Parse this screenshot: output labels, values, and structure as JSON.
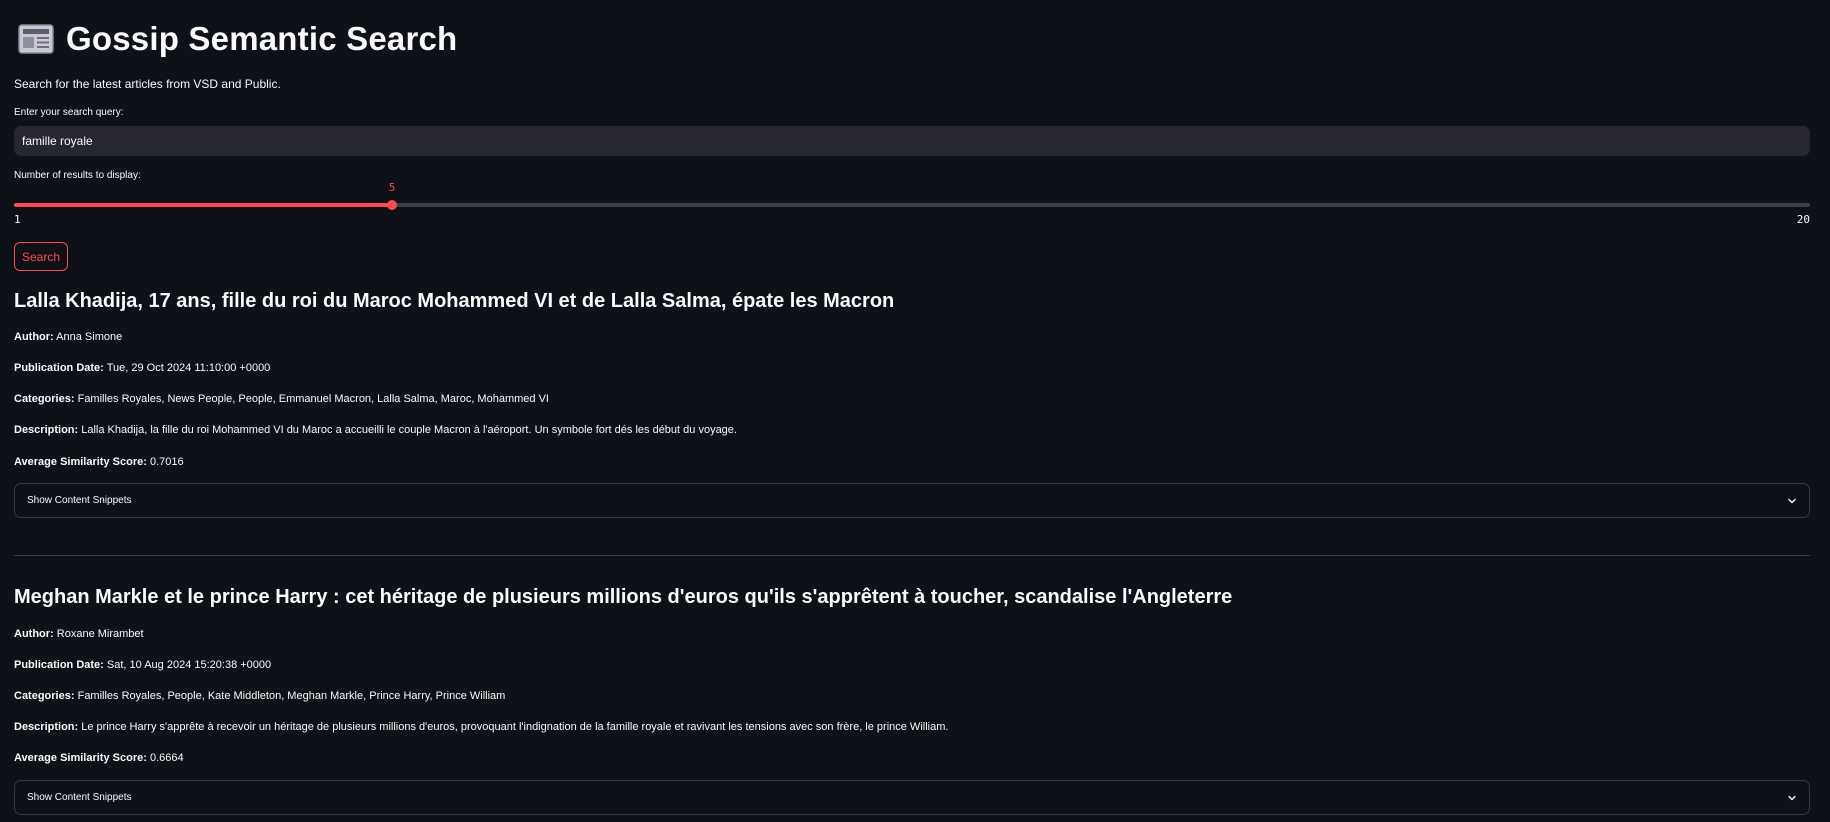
{
  "header": {
    "icon": "newspaper-icon",
    "title": "Gossip Semantic Search",
    "subtitle": "Search for the latest articles from VSD and Public."
  },
  "search": {
    "label": "Enter your search query:",
    "value": "famille royale"
  },
  "results_slider": {
    "label": "Number of results to display:",
    "value": 5,
    "value_text": "5",
    "min": 1,
    "max": 20,
    "min_text": "1",
    "max_text": "20",
    "accent_color": "#ff4b4b"
  },
  "search_button": {
    "label": "Search"
  },
  "labels": {
    "author": "Author:",
    "publication_date": "Publication Date:",
    "categories": "Categories:",
    "description": "Description:",
    "score": "Average Similarity Score:"
  },
  "articles": [
    {
      "title": "Lalla Khadija, 17 ans, fille du roi du Maroc Mohammed VI et de Lalla Salma, épate les Macron",
      "author": "Anna Simone",
      "publication_date": "Tue, 29 Oct 2024 11:10:00 +0000",
      "categories": "Familles Royales, News People, People, Emmanuel Macron, Lalla Salma, Maroc, Mohammed VI",
      "description": "Lalla Khadija, la fille du roi Mohammed VI du Maroc a accueilli le couple Macron à l'aéroport. Un symbole fort dés les début du voyage.",
      "score": "0.7016",
      "expander_label": "Show Content Snippets"
    },
    {
      "title": "Meghan Markle et le prince Harry : cet héritage de plusieurs millions d'euros qu'ils s'apprêtent à toucher, scandalise l'Angleterre",
      "author": "Roxane Mirambet",
      "publication_date": "Sat, 10 Aug 2024 15:20:38 +0000",
      "categories": "Familles Royales, People, Kate Middleton, Meghan Markle, Prince Harry, Prince William",
      "description": "Le prince Harry s'apprête à recevoir un héritage de plusieurs millions d'euros, provoquant l'indignation de la famille royale et ravivant les tensions avec son frère, le prince William.",
      "score": "0.6664",
      "expander_label": "Show Content Snippets"
    }
  ]
}
